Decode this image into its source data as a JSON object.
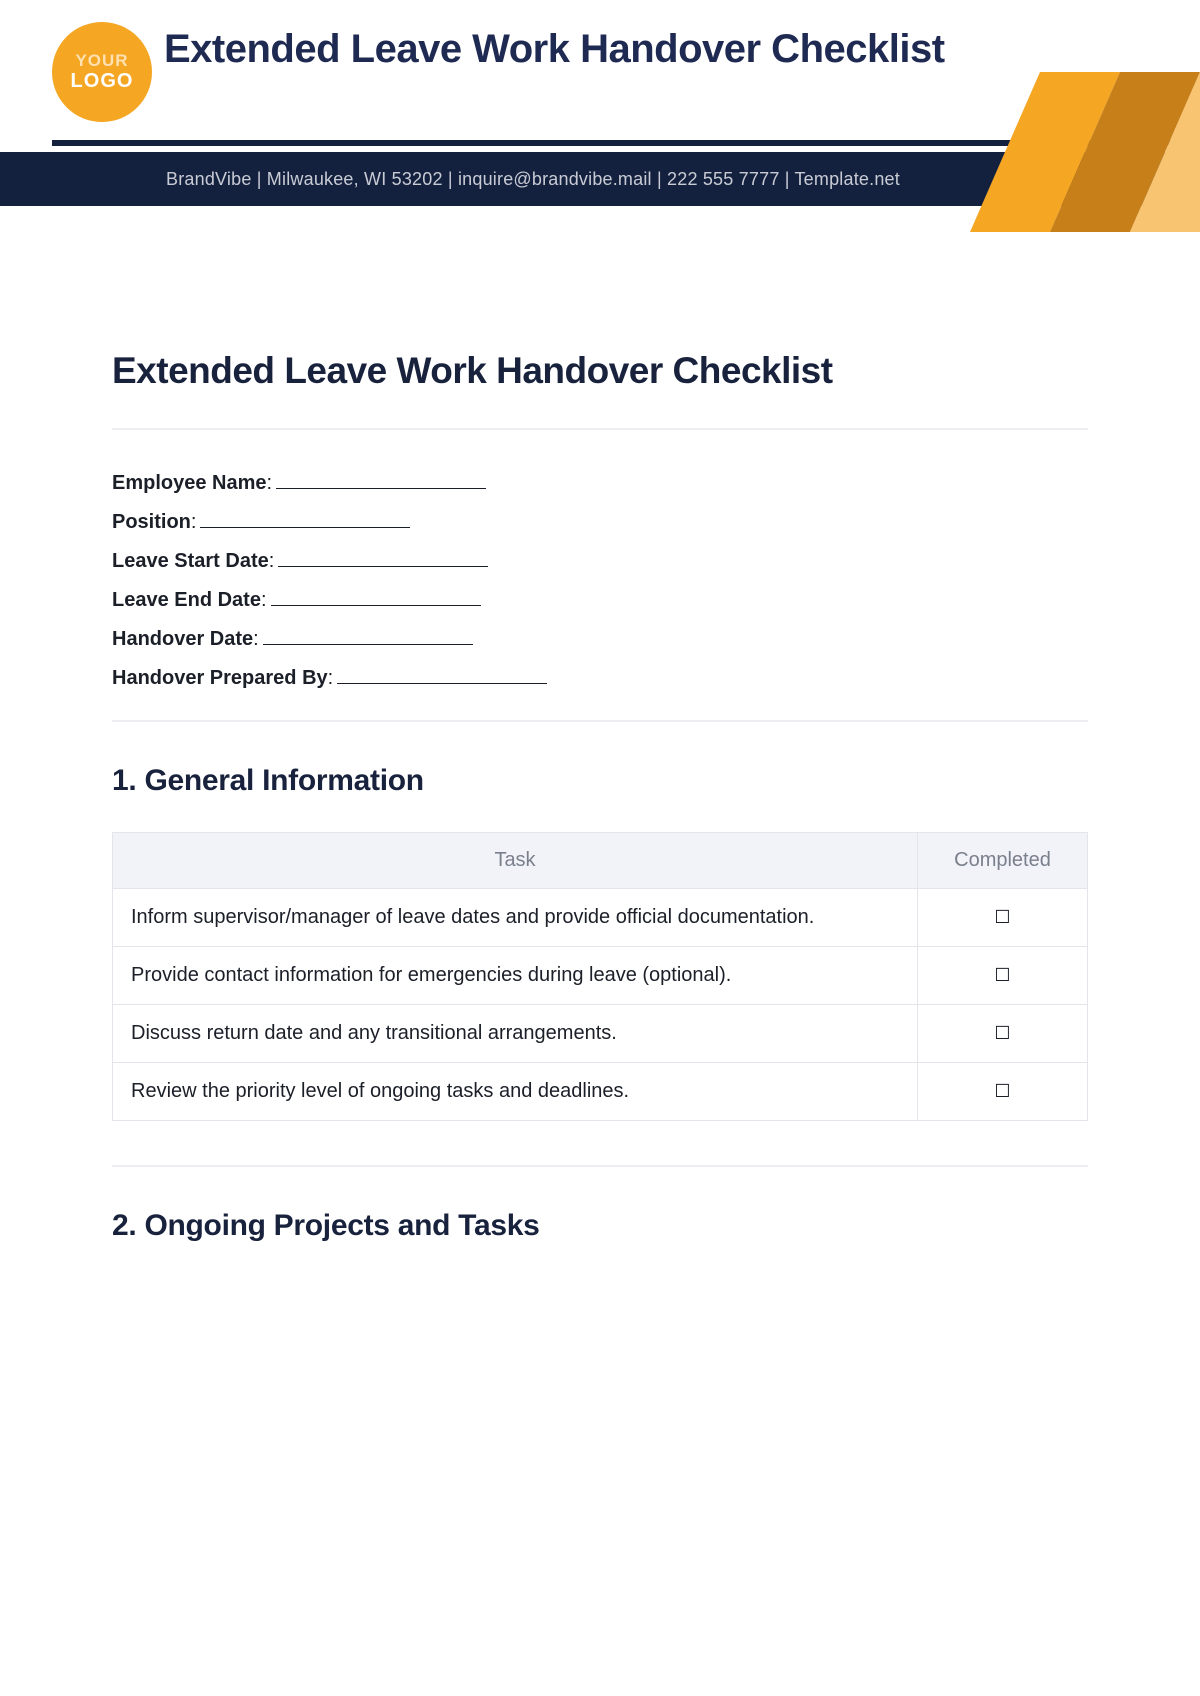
{
  "logo": {
    "line1": "YOUR",
    "line2": "LOGO"
  },
  "header_title": "Extended Leave Work Handover Checklist",
  "banner": "BrandVibe | Milwaukee, WI 53202 | inquire@brandvibe.mail | 222 555 7777 | Template.net",
  "main_title": "Extended Leave Work Handover Checklist",
  "fields": [
    {
      "label": "Employee Name"
    },
    {
      "label": "Position"
    },
    {
      "label": "Leave Start Date"
    },
    {
      "label": "Leave End Date"
    },
    {
      "label": "Handover Date"
    },
    {
      "label": "Handover Prepared By"
    }
  ],
  "section1": {
    "heading": "1. General Information",
    "col_task": "Task",
    "col_completed": "Completed",
    "rows": [
      "Inform supervisor/manager of leave dates and provide official documentation.",
      "Provide contact information for emergencies during leave (optional).",
      "Discuss return date and any transitional arrangements.",
      "Review the priority level of ongoing tasks and deadlines."
    ]
  },
  "section2": {
    "heading": "2. Ongoing Projects and Tasks"
  },
  "checkbox_glyph": "☐"
}
